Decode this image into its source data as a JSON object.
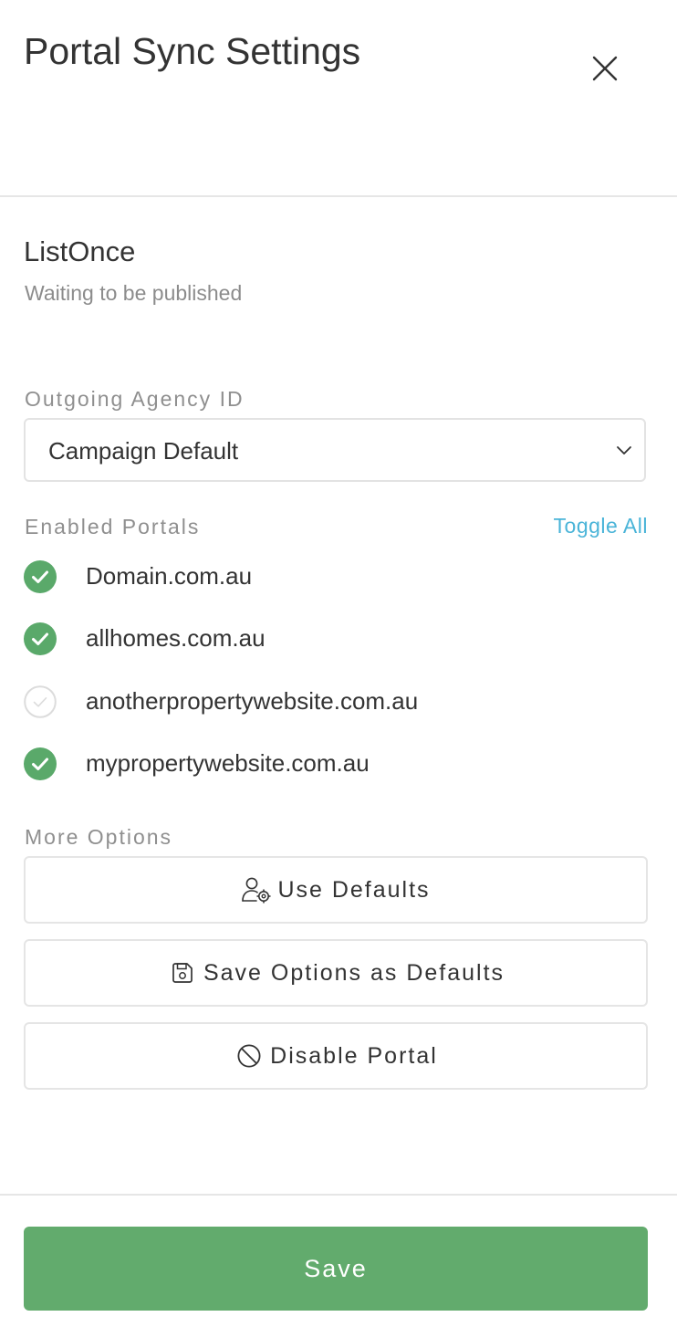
{
  "header": {
    "title": "Portal Sync Settings",
    "close_icon": "close-icon"
  },
  "portal": {
    "name": "ListOnce",
    "status": "Waiting to be published"
  },
  "agency": {
    "label": "Outgoing Agency ID",
    "selected": "Campaign Default"
  },
  "portals_section": {
    "label": "Enabled Portals",
    "toggle_all": "Toggle All",
    "items": [
      {
        "label": "Domain.com.au",
        "enabled": true
      },
      {
        "label": "allhomes.com.au",
        "enabled": true
      },
      {
        "label": "anotherpropertywebsite.com.au",
        "enabled": false
      },
      {
        "label": "mypropertywebsite.com.au",
        "enabled": true
      }
    ]
  },
  "more_options": {
    "label": "More Options",
    "use_defaults": "Use Defaults",
    "save_defaults": "Save Options as Defaults",
    "disable_portal": "Disable Portal"
  },
  "footer": {
    "save": "Save"
  },
  "colors": {
    "accent_green": "#62ab6d",
    "check_green": "#5aa96a",
    "link_blue": "#4ab4d8",
    "muted_text": "#8c8c8c"
  }
}
